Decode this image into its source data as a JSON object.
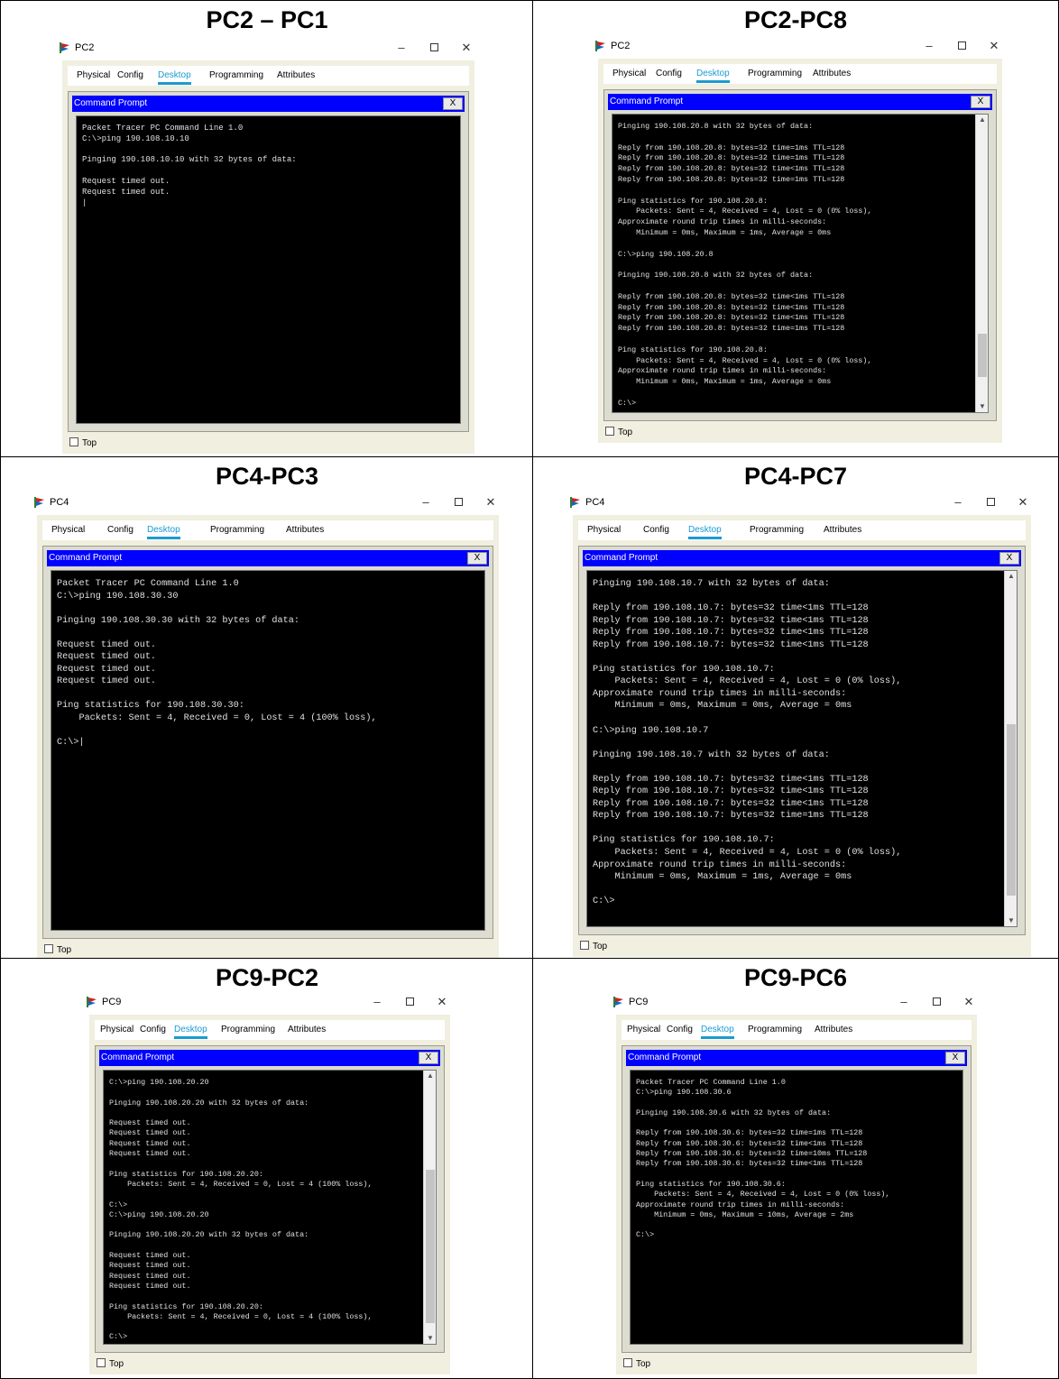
{
  "cells": [
    {
      "title": "PC2 – PC1",
      "window_title": "PC2",
      "tabs": [
        "Physical",
        "Config",
        "Desktop",
        "Programming",
        "Attributes"
      ],
      "active_tab": "Desktop",
      "prompt_title": "Command Prompt",
      "close_label": "X",
      "topmost_label": "Top",
      "has_scrollbar": false,
      "terminal": "Packet Tracer PC Command Line 1.0\nC:\\>ping 190.108.10.10\n\nPinging 190.108.10.10 with 32 bytes of data:\n\nRequest timed out.\nRequest timed out.\n|"
    },
    {
      "title": "PC2-PC8",
      "window_title": "PC2",
      "tabs": [
        "Physical",
        "Config",
        "Desktop",
        "Programming",
        "Attributes"
      ],
      "active_tab": "Desktop",
      "prompt_title": "Command Prompt",
      "close_label": "X",
      "topmost_label": "Top",
      "has_scrollbar": true,
      "terminal": "Pinging 190.108.20.8 with 32 bytes of data:\n\nReply from 190.108.20.8: bytes=32 time=1ms TTL=128\nReply from 190.108.20.8: bytes=32 time=1ms TTL=128\nReply from 190.108.20.8: bytes=32 time<1ms TTL=128\nReply from 190.108.20.8: bytes=32 time=1ms TTL=128\n\nPing statistics for 190.108.20.8:\n    Packets: Sent = 4, Received = 4, Lost = 0 (0% loss),\nApproximate round trip times in milli-seconds:\n    Minimum = 0ms, Maximum = 1ms, Average = 0ms\n\nC:\\>ping 190.108.20.8\n\nPinging 190.108.20.8 with 32 bytes of data:\n\nReply from 190.108.20.8: bytes=32 time<1ms TTL=128\nReply from 190.108.20.8: bytes=32 time<1ms TTL=128\nReply from 190.108.20.8: bytes=32 time<1ms TTL=128\nReply from 190.108.20.8: bytes=32 time=1ms TTL=128\n\nPing statistics for 190.108.20.8:\n    Packets: Sent = 4, Received = 4, Lost = 0 (0% loss),\nApproximate round trip times in milli-seconds:\n    Minimum = 0ms, Maximum = 1ms, Average = 0ms\n\nC:\\>"
    },
    {
      "title": "PC4-PC3",
      "window_title": "PC4",
      "tabs": [
        "Physical",
        "Config",
        "Desktop",
        "Programming",
        "Attributes"
      ],
      "active_tab": "Desktop",
      "prompt_title": "Command Prompt",
      "close_label": "X",
      "topmost_label": "Top",
      "has_scrollbar": false,
      "terminal": "Packet Tracer PC Command Line 1.0\nC:\\>ping 190.108.30.30\n\nPinging 190.108.30.30 with 32 bytes of data:\n\nRequest timed out.\nRequest timed out.\nRequest timed out.\nRequest timed out.\n\nPing statistics for 190.108.30.30:\n    Packets: Sent = 4, Received = 0, Lost = 4 (100% loss),\n\nC:\\>|"
    },
    {
      "title": "PC4-PC7",
      "window_title": "PC4",
      "tabs": [
        "Physical",
        "Config",
        "Desktop",
        "Programming",
        "Attributes"
      ],
      "active_tab": "Desktop",
      "prompt_title": "Command Prompt",
      "close_label": "X",
      "topmost_label": "Top",
      "has_scrollbar": true,
      "terminal": "Pinging 190.108.10.7 with 32 bytes of data:\n\nReply from 190.108.10.7: bytes=32 time<1ms TTL=128\nReply from 190.108.10.7: bytes=32 time<1ms TTL=128\nReply from 190.108.10.7: bytes=32 time<1ms TTL=128\nReply from 190.108.10.7: bytes=32 time<1ms TTL=128\n\nPing statistics for 190.108.10.7:\n    Packets: Sent = 4, Received = 4, Lost = 0 (0% loss),\nApproximate round trip times in milli-seconds:\n    Minimum = 0ms, Maximum = 0ms, Average = 0ms\n\nC:\\>ping 190.108.10.7\n\nPinging 190.108.10.7 with 32 bytes of data:\n\nReply from 190.108.10.7: bytes=32 time<1ms TTL=128\nReply from 190.108.10.7: bytes=32 time<1ms TTL=128\nReply from 190.108.10.7: bytes=32 time<1ms TTL=128\nReply from 190.108.10.7: bytes=32 time=1ms TTL=128\n\nPing statistics for 190.108.10.7:\n    Packets: Sent = 4, Received = 4, Lost = 0 (0% loss),\nApproximate round trip times in milli-seconds:\n    Minimum = 0ms, Maximum = 1ms, Average = 0ms\n\nC:\\>"
    },
    {
      "title": "PC9-PC2",
      "window_title": "PC9",
      "tabs": [
        "Physical",
        "Config",
        "Desktop",
        "Programming",
        "Attributes"
      ],
      "active_tab": "Desktop",
      "prompt_title": "Command Prompt",
      "close_label": "X",
      "topmost_label": "Top",
      "has_scrollbar": true,
      "terminal": "C:\\>ping 190.108.20.20\n\nPinging 190.108.20.20 with 32 bytes of data:\n\nRequest timed out.\nRequest timed out.\nRequest timed out.\nRequest timed out.\n\nPing statistics for 190.108.20.20:\n    Packets: Sent = 4, Received = 0, Lost = 4 (100% loss),\n\nC:\\>\nC:\\>ping 190.108.20.20\n\nPinging 190.108.20.20 with 32 bytes of data:\n\nRequest timed out.\nRequest timed out.\nRequest timed out.\nRequest timed out.\n\nPing statistics for 190.108.20.20:\n    Packets: Sent = 4, Received = 0, Lost = 4 (100% loss),\n\nC:\\>\nC:\\>"
    },
    {
      "title": "PC9-PC6",
      "window_title": "PC9",
      "tabs": [
        "Physical",
        "Config",
        "Desktop",
        "Programming",
        "Attributes"
      ],
      "active_tab": "Desktop",
      "prompt_title": "Command Prompt",
      "close_label": "X",
      "topmost_label": "Top",
      "has_scrollbar": false,
      "terminal": "Packet Tracer PC Command Line 1.0\nC:\\>ping 190.108.30.6\n\nPinging 190.108.30.6 with 32 bytes of data:\n\nReply from 190.108.30.6: bytes=32 time=1ms TTL=128\nReply from 190.108.30.6: bytes=32 time<1ms TTL=128\nReply from 190.108.30.6: bytes=32 time=10ms TTL=128\nReply from 190.108.30.6: bytes=32 time<1ms TTL=128\n\nPing statistics for 190.108.30.6:\n    Packets: Sent = 4, Received = 4, Lost = 0 (0% loss),\nApproximate round trip times in milli-seconds:\n    Minimum = 0ms, Maximum = 10ms, Average = 2ms\n\nC:\\>"
    }
  ]
}
